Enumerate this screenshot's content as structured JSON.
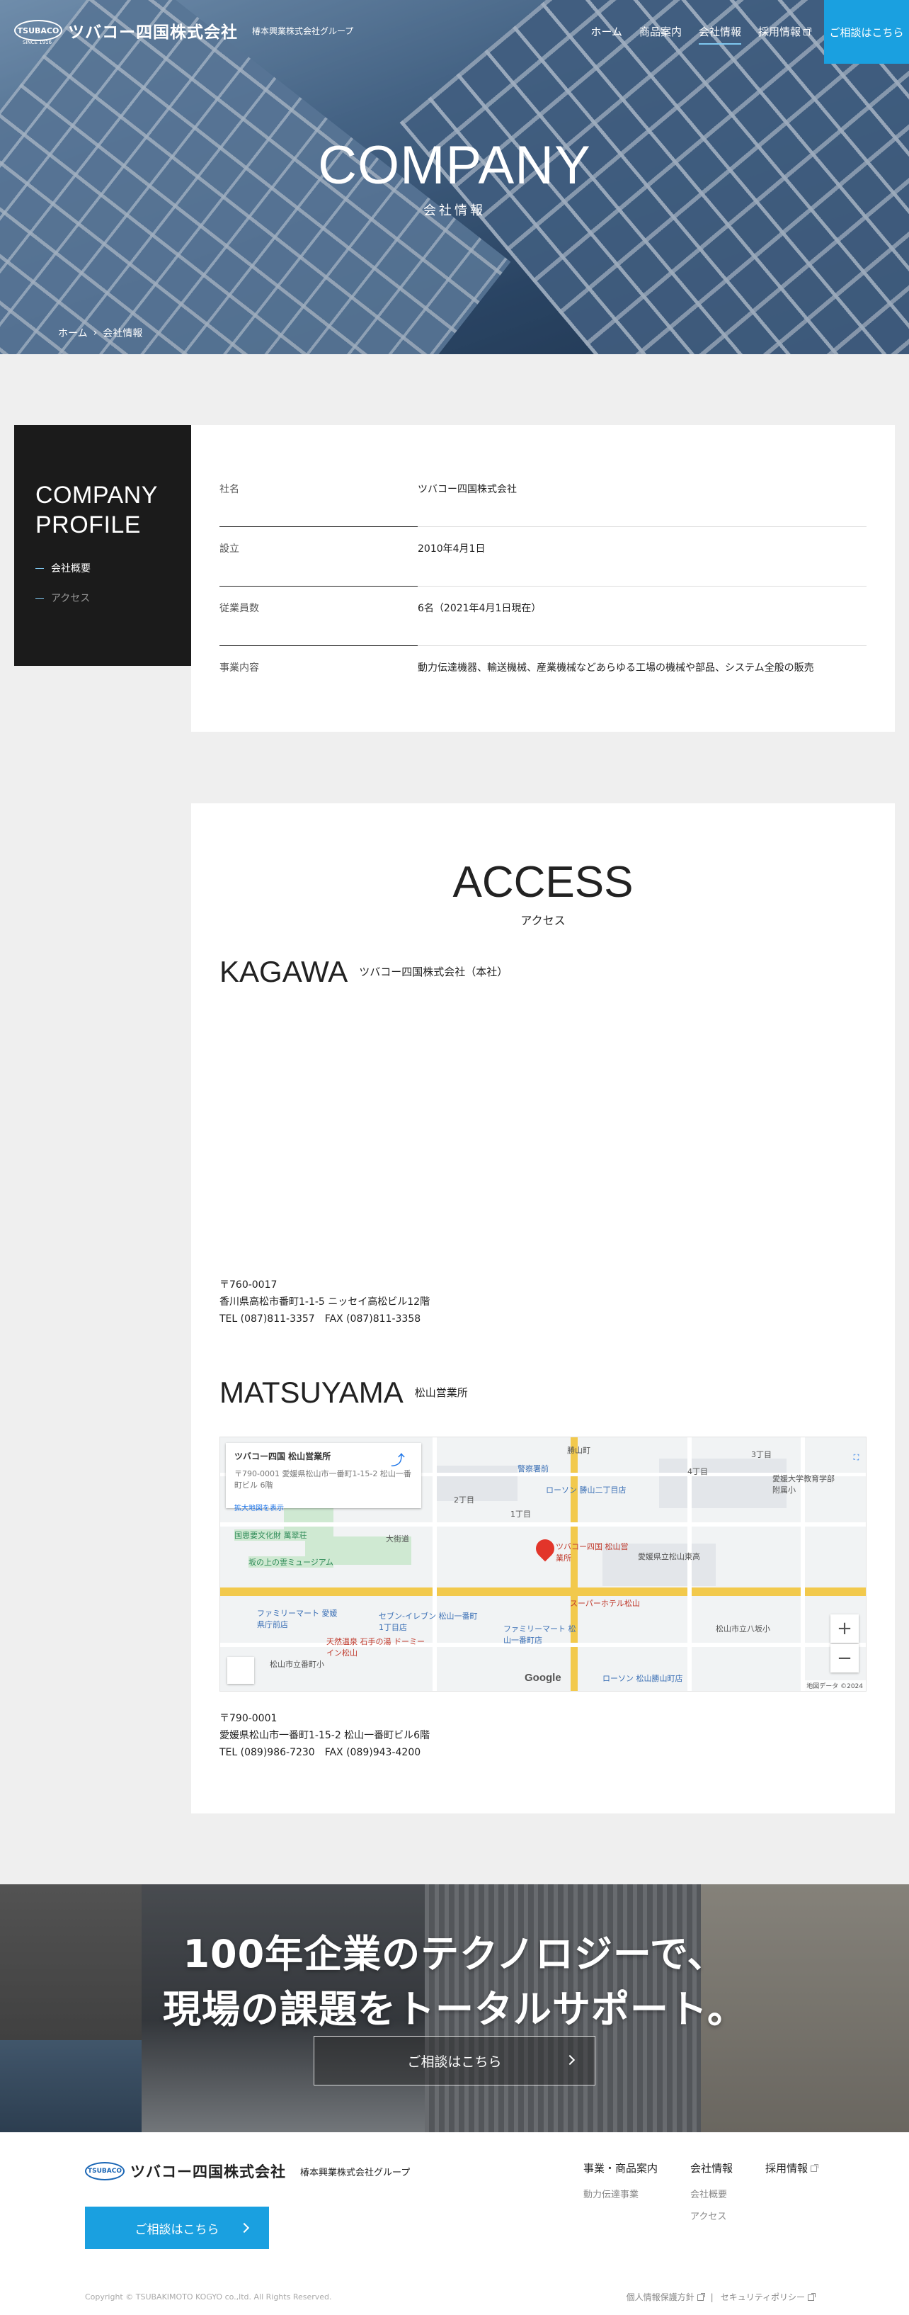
{
  "header": {
    "logo_badge": "TSUBACO",
    "logo_since": "SINCE 1916",
    "logo_name": "ツバコー四国株式会社",
    "group": "椿本興業株式会社グループ",
    "nav": [
      "ホーム",
      "商品案内",
      "会社情報",
      "採用情報"
    ],
    "cta": "ご相談はこちら"
  },
  "hero": {
    "title": "COMPANY",
    "subtitle": "会社情報",
    "breadcrumb": [
      "ホーム",
      "会社情報"
    ]
  },
  "sidebar": {
    "title_line1": "COMPANY",
    "title_line2": "PROFILE",
    "links": [
      "会社概要",
      "アクセス"
    ]
  },
  "profile": [
    {
      "label": "社名",
      "value": "ツバコー四国株式会社"
    },
    {
      "label": "設立",
      "value": "2010年4月1日"
    },
    {
      "label": "従業員数",
      "value": "6名（2021年4月1日現在）"
    },
    {
      "label": "事業内容",
      "value": "動力伝達機器、輸送機械、産業機械などあらゆる工場の機械や部品、システム全般の販売"
    }
  ],
  "access": {
    "title": "ACCESS",
    "subtitle": "アクセス",
    "kagawa": {
      "name_en": "KAGAWA",
      "name_jp": "ツバコー四国株式会社（本社）",
      "postal": "〒760-0017",
      "address": "香川県高松市番町1-1-5 ニッセイ高松ビル12階",
      "tel": "TEL (087)811-3357　FAX (087)811-3358"
    },
    "matsuyama": {
      "name_en": "MATSUYAMA",
      "name_jp": "松山営業所",
      "postal": "〒790-0001",
      "address": "愛媛県松山市一番町1-15-2 松山一番町ビル6階",
      "tel": "TEL (089)986-7230　FAX (089)943-4200"
    }
  },
  "map": {
    "info_title": "ツバコー四国 松山営業所",
    "info_address": "〒790-0001 愛媛県松山市一番町1-15-2 松山一番町ビル 6階",
    "info_link": "拡大地図を表示",
    "directions": "ルート",
    "place_labels": [
      "勝山町",
      "警察署前",
      "ローソン 勝山二丁目店",
      "国患要文化財 萬翠荘",
      "坂の上の雲ミュージアム",
      "大街道",
      "ツバコー四国 松山営業所",
      "愛媛県立松山東高",
      "スーパーホテル松山",
      "ファミリーマート 愛媛県庁前店",
      "セブン-イレブン 松山一番町1丁目店",
      "ファミリーマート 松山一番町店",
      "天然温泉 石手の湯 ドーミーイン松山",
      "松山市立番町小",
      "ローソン 松山勝山町店",
      "松山市立八坂小",
      "愛媛大学教育学部附属小",
      "4丁目",
      "3丁目",
      "2丁目",
      "1丁目"
    ],
    "google": "Google",
    "credit": "地図データ ©2024",
    "zoom_in": "+",
    "zoom_out": "−"
  },
  "banner": {
    "line1": "100年企業のテクノロジーで、",
    "line2": "現場の課題をトータルサポート。",
    "button": "ご相談はこちら"
  },
  "footer": {
    "logo_badge": "TSUBACO",
    "logo_since": "SINCE 1916",
    "logo_name": "ツバコー四国株式会社",
    "group": "椿本興業株式会社グループ",
    "cta": "ご相談はこちら",
    "cols": [
      {
        "heading": "事業・商品案内",
        "items": [
          "動力伝達事業"
        ]
      },
      {
        "heading": "会社情報",
        "items": [
          "会社概要",
          "アクセス"
        ]
      },
      {
        "heading": "採用情報",
        "items": []
      }
    ],
    "copyright": "Copyright © TSUBAKIMOTO KOGYO co.,ltd. All Rights Reserved.",
    "legal": [
      "個人情報保護方針",
      "セキュリティポリシー"
    ]
  },
  "colors": {
    "accent": "#1aa0e0",
    "dark_panel": "#1b1b1b",
    "background": "#efefef"
  }
}
